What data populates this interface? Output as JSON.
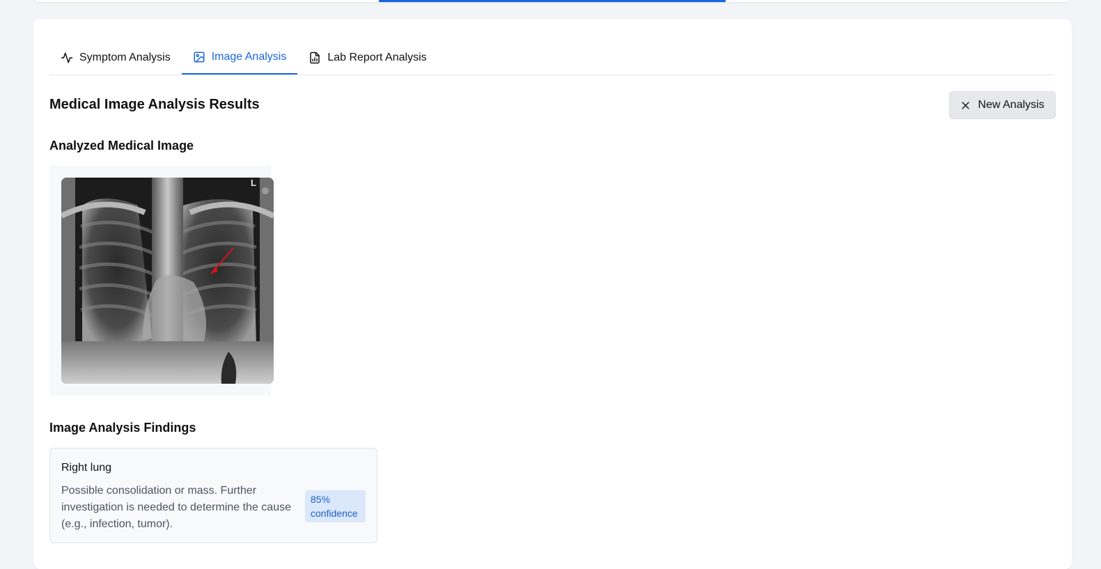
{
  "tabs": [
    {
      "label": "Symptom Analysis",
      "icon": "activity-icon",
      "active": false
    },
    {
      "label": "Image Analysis",
      "icon": "image-icon",
      "active": true
    },
    {
      "label": "Lab Report Analysis",
      "icon": "file-chart-icon",
      "active": false
    }
  ],
  "results": {
    "title": "Medical Image Analysis Results",
    "new_analysis_label": "New Analysis"
  },
  "image_section": {
    "title": "Analyzed Medical Image",
    "image_marker": "L"
  },
  "findings": {
    "title": "Image Analysis Findings",
    "items": [
      {
        "region": "Right lung",
        "description": "Possible consolidation or mass. Further investigation is needed to determine the cause (e.g., infection, tumor).",
        "confidence": "85% confidence"
      }
    ]
  },
  "colors": {
    "accent": "#1a66e0",
    "badge_bg": "#dbe8fb",
    "arrow": "#e0101a"
  }
}
